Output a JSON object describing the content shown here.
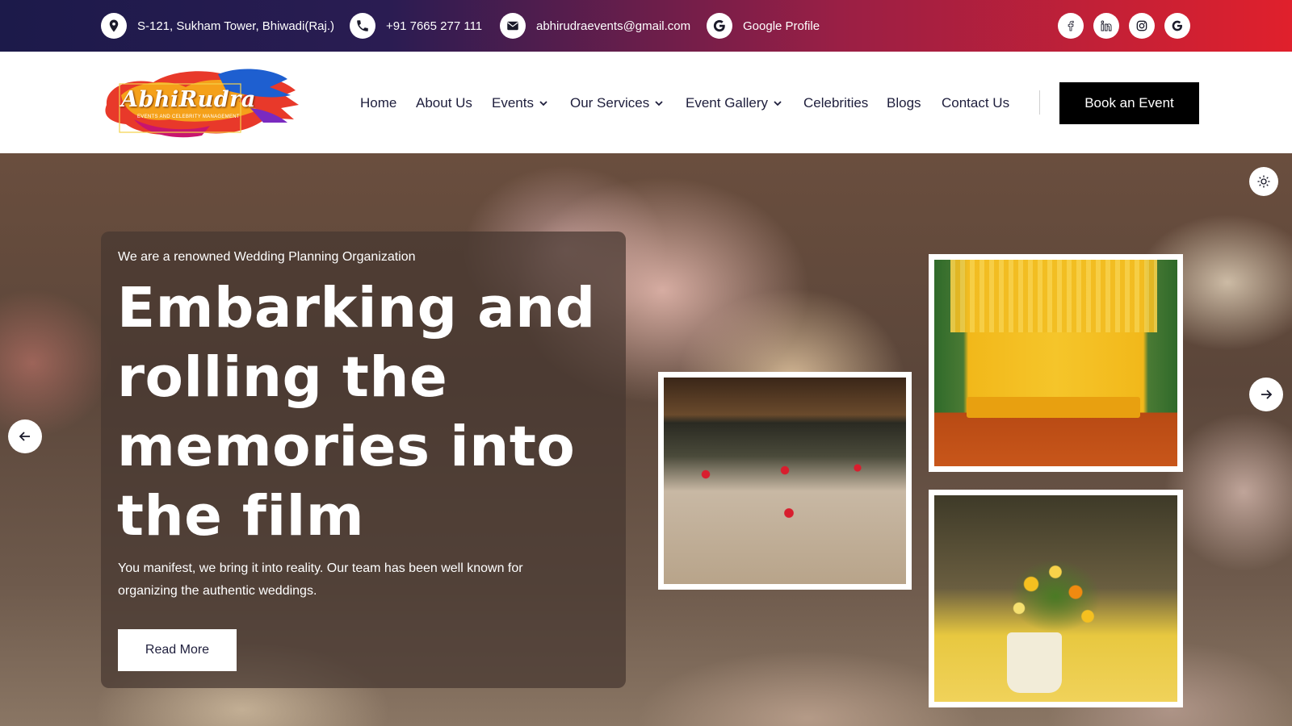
{
  "topbar": {
    "address": "S-121, Sukham Tower, Bhiwadi(Raj.)",
    "phone": "+91 7665 277 111",
    "email": "abhirudraevents@gmail.com",
    "google_profile": "Google Profile",
    "icons": [
      "location-icon",
      "phone-icon",
      "mail-icon",
      "google-icon"
    ],
    "social": [
      "facebook-icon",
      "linkedin-icon",
      "instagram-icon",
      "google-icon"
    ]
  },
  "header": {
    "logo": {
      "name": "AbhiRudra",
      "tagline": "EVENTS AND CELEBRITY MANAGEMENT"
    },
    "nav": [
      {
        "label": "Home",
        "dropdown": false
      },
      {
        "label": "About Us",
        "dropdown": false
      },
      {
        "label": "Events",
        "dropdown": true
      },
      {
        "label": "Our Services",
        "dropdown": true
      },
      {
        "label": "Event Gallery",
        "dropdown": true
      },
      {
        "label": "Celebrities",
        "dropdown": false
      },
      {
        "label": "Blogs",
        "dropdown": false
      },
      {
        "label": "Contact Us",
        "dropdown": false
      }
    ],
    "cta": "Book an Event"
  },
  "hero": {
    "eyebrow": "We are a renowned Wedding Planning Organization",
    "headline": "Embarking and rolling the memories into the film",
    "description": "You manifest, we bring it into reality. Our team has been well known for organizing the authentic weddings.",
    "button": "Read More",
    "images": [
      "banquet-hall-photo",
      "yellow-mandap-photo",
      "flower-vase-photo"
    ]
  },
  "colors": {
    "topbar_start": "#1c1a4a",
    "topbar_end": "#e0202c",
    "cta_bg": "#000000",
    "nav_text": "#1e1e3c"
  }
}
